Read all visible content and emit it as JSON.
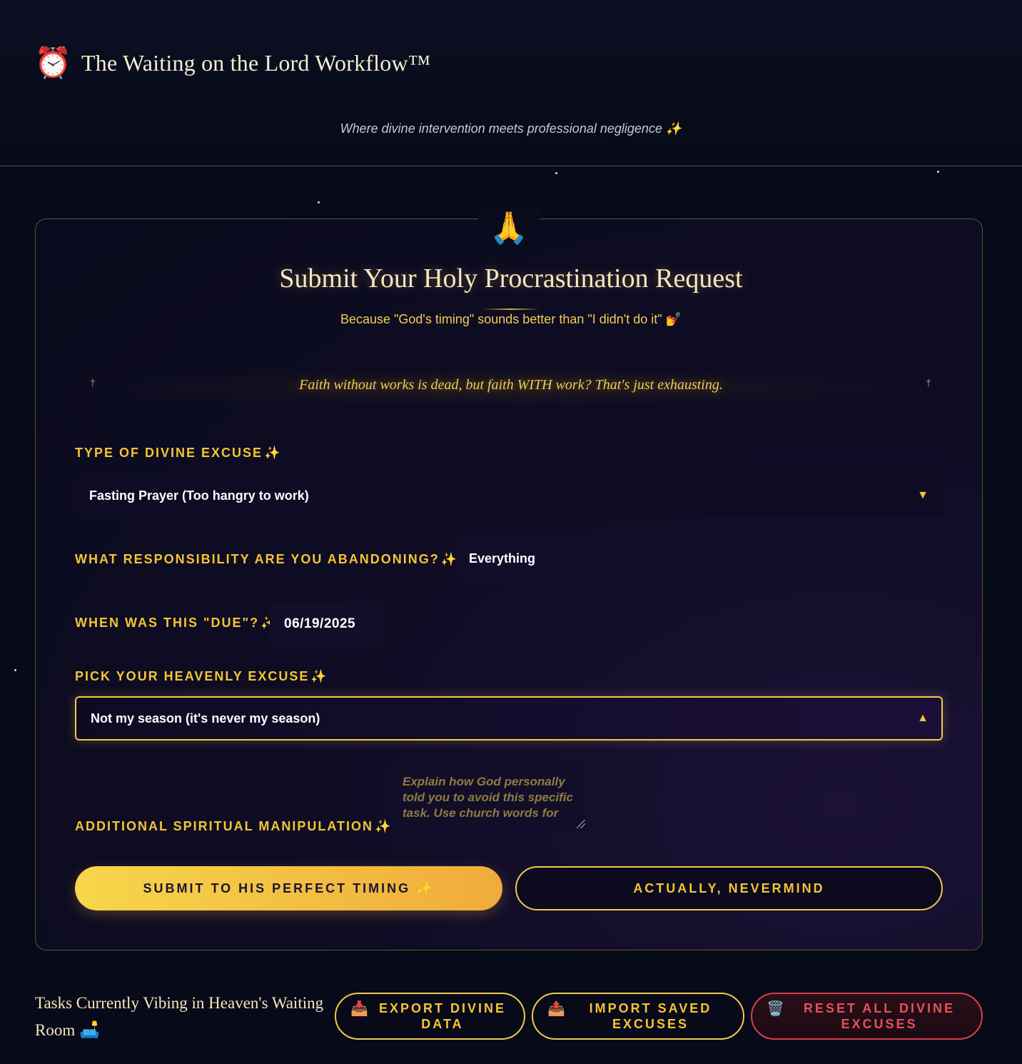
{
  "header": {
    "icon": "alarm-clock-icon",
    "icon_glyph": "⏰",
    "title": "The Waiting on the Lord Workflow™",
    "tagline": "Where divine intervention meets professional negligence ✨"
  },
  "card": {
    "icon": "praying-hands-icon",
    "icon_glyph": "🙏",
    "title": "Submit Your Holy Procrastination Request",
    "subtitle": "Because \"God's timing\" sounds better than \"I didn't do it\" 💅",
    "cross_glyph": "†",
    "quote": "Faith without works is dead, but faith WITH work? That's just exhausting."
  },
  "form": {
    "excuse_type": {
      "label": "Type of Divine Excuse",
      "spark": "✨",
      "value": "Fasting Prayer (Too hangry to work)",
      "caret": "▼"
    },
    "responsibility": {
      "label": "What responsibility are you abandoning?",
      "spark": "✨",
      "value": "Everything"
    },
    "due": {
      "label": "When was this \"due\"?",
      "spark": "✨",
      "value": "06/19/2025"
    },
    "heavenly_excuse": {
      "label": "Pick Your Heavenly Excuse",
      "spark": "✨",
      "value": "Not my season (it's never my season)",
      "caret": "▲"
    },
    "manipulation": {
      "label": "Additional Spiritual Manipulation",
      "spark": "✨",
      "placeholder": "Explain how God personally told you to avoid this specific task. Use church words for"
    },
    "submit_label": "Submit to His Perfect Timing ✨",
    "cancel_label": "Actually, Nevermind"
  },
  "bottom": {
    "title": "Tasks Currently Vibing in Heaven's Waiting Room 🛋️",
    "export": {
      "icon": "inbox-tray-icon",
      "glyph": "📥",
      "label": "Export Divine Data"
    },
    "import": {
      "icon": "outbox-tray-icon",
      "glyph": "📤",
      "label": "Import Saved Excuses"
    },
    "reset": {
      "icon": "wastebasket-icon",
      "glyph": "🗑️",
      "label": "Reset All Divine Excuses"
    }
  },
  "colors": {
    "background": "#070a18",
    "gold": "#f4c534",
    "danger": "#e4515b"
  }
}
